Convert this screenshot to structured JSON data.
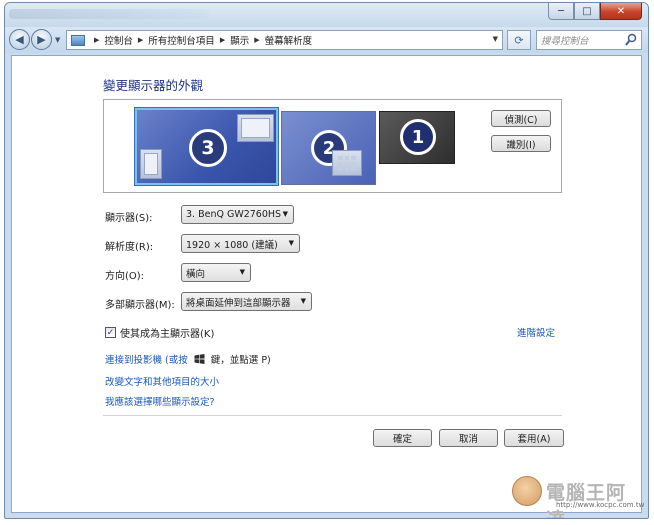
{
  "window": {
    "caption": {
      "minimize": "─",
      "maximize": "□",
      "close": "✕"
    }
  },
  "navbar": {
    "breadcrumbs": [
      "控制台",
      "所有控制台項目",
      "顯示",
      "螢幕解析度"
    ],
    "search_placeholder": "搜尋控制台"
  },
  "main": {
    "heading": "變更顯示器的外觀",
    "monitors": [
      {
        "number": "3",
        "selected": true
      },
      {
        "number": "2",
        "selected": false
      },
      {
        "number": "1",
        "selected": false
      }
    ],
    "detect_label": "偵測(C)",
    "identify_label": "識別(I)",
    "display_label": "顯示器(S):",
    "display_value": "3. BenQ GW2760HS",
    "resolution_label": "解析度(R):",
    "resolution_value": "1920 × 1080 (建議)",
    "orientation_label": "方向(O):",
    "orientation_value": "橫向",
    "multiple_label": "多部顯示器(M):",
    "multiple_value": "將桌面延伸到這部顯示器",
    "primary_checkbox_label": "使其成為主顯示器(K)",
    "primary_checked": true,
    "advanced_link": "進階設定",
    "projector_link_pre": "連接到投影機 (或按",
    "projector_link_post": "鍵，並點選 P)",
    "text_size_link": "改變文字和其他項目的大小",
    "which_settings_link": "我應該選擇哪些顯示設定?"
  },
  "footer": {
    "ok_label": "確定",
    "cancel_label": "取消",
    "apply_label": "套用(A)"
  },
  "watermark": {
    "text": "電腦王阿達",
    "url": "http://www.kocpc.com.tw"
  },
  "colors": {
    "heading": "#1e3287",
    "link": "#1a58b8",
    "selected_monitor_border": "#7fbef2"
  },
  "icons": [
    "back-arrow-icon",
    "forward-arrow-icon",
    "control-panel-icon",
    "refresh-icon",
    "search-icon",
    "windows-logo-icon",
    "checkmark-icon"
  ]
}
